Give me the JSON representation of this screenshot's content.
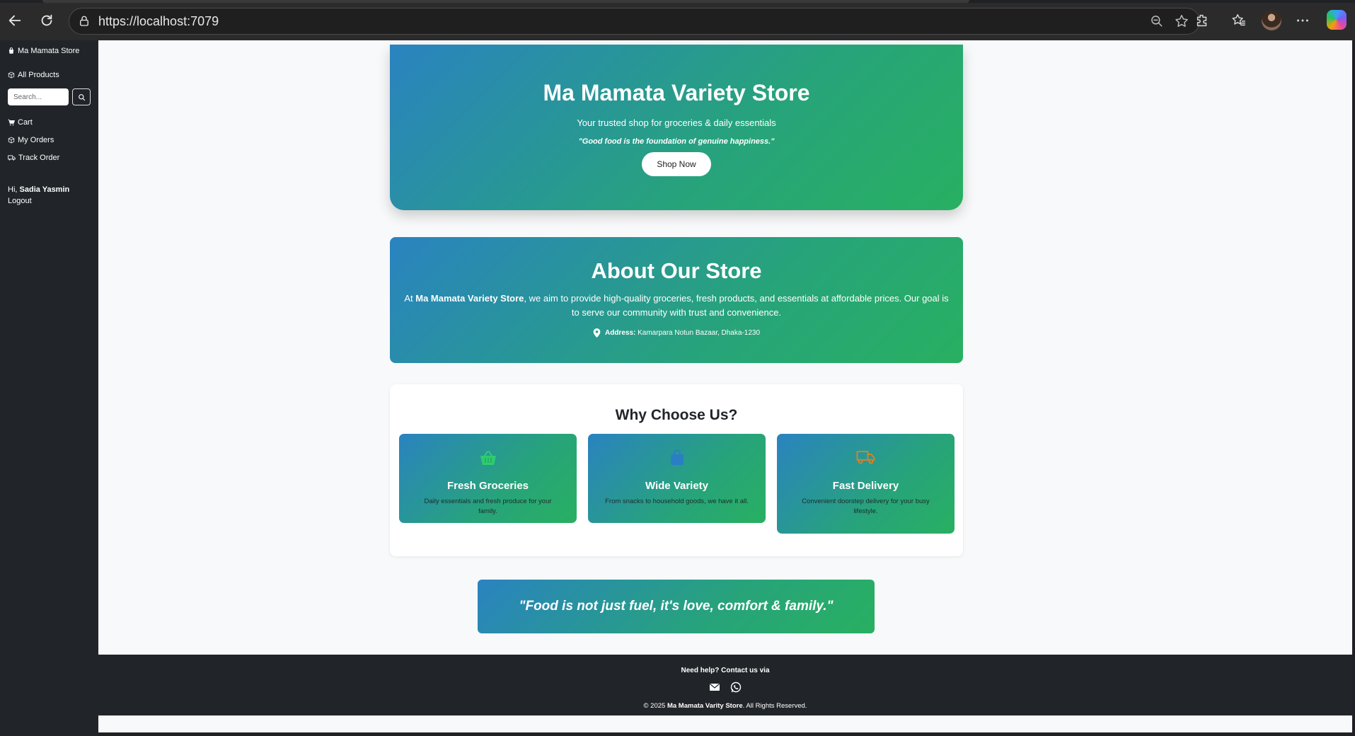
{
  "browser": {
    "url": "https://localhost:7079"
  },
  "sidebar": {
    "brand": "Ma Mamata Store",
    "all_products": "All Products",
    "search_placeholder": "Search...",
    "cart": "Cart",
    "my_orders": "My Orders",
    "track_order": "Track Order",
    "greeting": "Hi,",
    "user_name": "Sadia Yasmin",
    "logout": "Logout"
  },
  "hero": {
    "title": "Ma Mamata Variety Store",
    "subtitle": "Your trusted shop for groceries & daily essentials",
    "quote": "\"Good food is the foundation of genuine happiness.\"",
    "button": "Shop Now"
  },
  "about": {
    "title": "About Our Store",
    "text_prefix": "At ",
    "store_name": "Ma Mamata Variety Store",
    "text_suffix": ", we aim to provide high-quality groceries, fresh products, and essentials at affordable prices. Our goal is to serve our community with trust and convenience.",
    "address_label": "Address:",
    "address": "Kamarpara Notun Bazaar, Dhaka-1230"
  },
  "why": {
    "title": "Why Choose Us?",
    "cards": [
      {
        "icon": "basket-icon",
        "icon_color": "#2ecc71",
        "title": "Fresh Groceries",
        "desc": "Daily essentials and fresh produce for your family."
      },
      {
        "icon": "bag-icon",
        "icon_color": "#2a7fc4",
        "title": "Wide Variety",
        "desc": "From snacks to household goods, we have it all."
      },
      {
        "icon": "truck-icon",
        "icon_color": "#e67e22",
        "title": "Fast Delivery",
        "desc": "Convenient doorstep delivery for your busy lifestyle."
      }
    ]
  },
  "bottom_quote": "\"Food is not just fuel, it's love, comfort & family.\"",
  "footer": {
    "help": "Need help? Contact us via",
    "copyright_prefix": "© 2025 ",
    "copyright_name": "Ma Mamata Varity Store",
    "copyright_suffix": ". All Rights Reserved."
  },
  "colors": {
    "gradient_start": "#2a83c0",
    "gradient_end": "#28b061",
    "sidebar_bg": "#212529"
  }
}
